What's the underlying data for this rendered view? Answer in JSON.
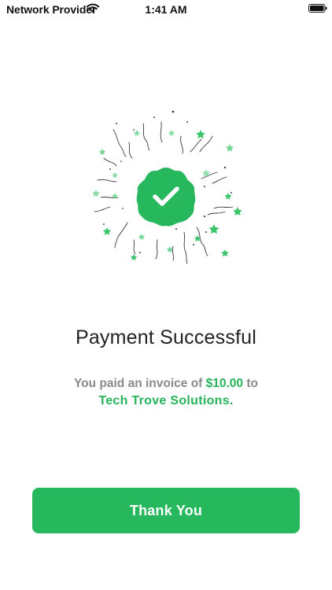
{
  "status_bar": {
    "carrier": "Network Provider",
    "time": "1:41 AM"
  },
  "illustration": {
    "badge_icon": "checkmark-icon",
    "accent_color": "#27b85d"
  },
  "content": {
    "title": "Payment Successful",
    "message_prefix": "You paid an invoice of ",
    "amount": "$10.00",
    "message_suffix": " to",
    "company": "Tech Trove Solutions."
  },
  "actions": {
    "primary_label": "Thank You"
  },
  "colors": {
    "accent": "#27b85d",
    "text_primary": "#222222",
    "text_secondary": "#8a8a8a"
  }
}
